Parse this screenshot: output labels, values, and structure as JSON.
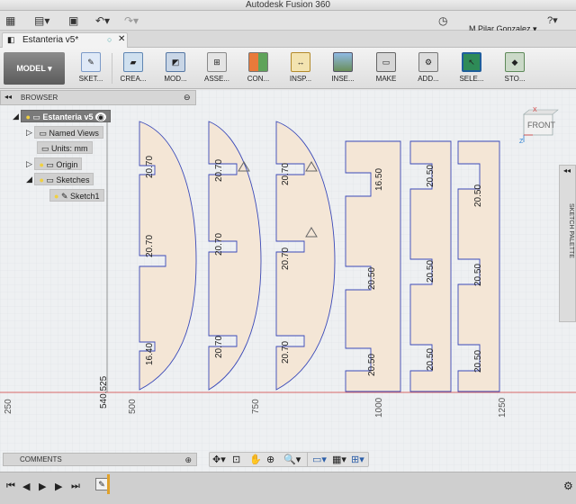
{
  "window": {
    "title": "Autodesk Fusion 360"
  },
  "appbar": {
    "user_name": "M Pilar Gonzalez"
  },
  "document_tab": {
    "title": "Estanteria v5*"
  },
  "toolbar": {
    "workspace": "MODEL",
    "tools": [
      "SKET...",
      "CREA...",
      "MOD...",
      "ASSE...",
      "CON...",
      "INSP...",
      "INSE...",
      "MAKE",
      "ADD...",
      "SELE...",
      "STO..."
    ]
  },
  "browser": {
    "title": "BROWSER",
    "root": "Estanteria v5",
    "named_views": "Named Views",
    "units": "Units: mm",
    "origin": "Origin",
    "sketches": "Sketches",
    "sketch1": "Sketch1"
  },
  "viewcube": {
    "face": "FRONT",
    "axis_x": "X",
    "axis_z": "Z"
  },
  "sketch_palette": {
    "label": "SKETCH PALETTE"
  },
  "comments": {
    "label": "COMMENTS"
  },
  "axis_labels": [
    "250",
    "500",
    "750",
    "1000",
    "1250"
  ],
  "dimensions": {
    "p1": [
      "20.70",
      "20.70",
      "16.40"
    ],
    "p2": [
      "20.70",
      "20.70",
      "20.70"
    ],
    "p3": [
      "20.70",
      "20.70",
      "20.70"
    ],
    "p4": [
      "16.50",
      "20.50",
      "20.50"
    ],
    "p5": [
      "20.50",
      "20.50",
      "20.50"
    ],
    "p6": [
      "20.50",
      "20.50",
      "20.50"
    ],
    "vertical": "540.525",
    "small": "20.70"
  },
  "colors": {
    "panel_fill": "#f4e6d6",
    "sketch_line": "#3a49b8",
    "axis_red": "#d23a3a",
    "accent_blue": "#2b7fd1"
  }
}
